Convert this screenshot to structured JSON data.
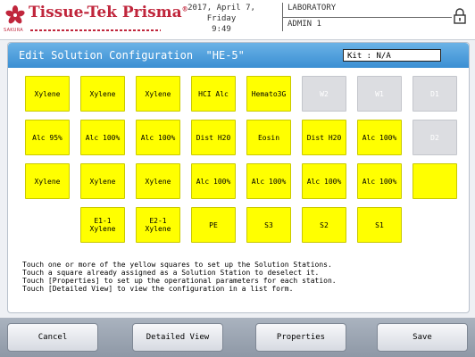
{
  "header": {
    "brand": "Tissue-Tek Prisma",
    "brand_sub": "SAKURA",
    "date_line1": "2017, April 7, Friday",
    "date_line2": "9:49",
    "lab": "LABORATORY",
    "user": "ADMIN 1"
  },
  "panel": {
    "title": "Edit Solution Configuration  \"HE-5\"",
    "kit": "Kit : N/A"
  },
  "grid": {
    "rows": [
      [
        {
          "label": "Xylene",
          "state": "yellow"
        },
        {
          "label": "Xylene",
          "state": "yellow"
        },
        {
          "label": "Xylene",
          "state": "yellow"
        },
        {
          "label": "HCI Alc",
          "state": "yellow"
        },
        {
          "label": "Hemato3G",
          "state": "yellow"
        },
        {
          "label": "W2",
          "state": "gray"
        },
        {
          "label": "W1",
          "state": "gray"
        },
        {
          "label": "D1",
          "state": "gray"
        }
      ],
      [
        {
          "label": "Alc 95%",
          "state": "yellow"
        },
        {
          "label": "Alc 100%",
          "state": "yellow"
        },
        {
          "label": "Alc 100%",
          "state": "yellow"
        },
        {
          "label": "Dist H20",
          "state": "yellow"
        },
        {
          "label": "Eosin",
          "state": "yellow"
        },
        {
          "label": "Dist H20",
          "state": "yellow"
        },
        {
          "label": "Alc 100%",
          "state": "yellow"
        },
        {
          "label": "D2",
          "state": "gray"
        }
      ],
      [
        {
          "label": "Xylene",
          "state": "yellow"
        },
        {
          "label": "Xylene",
          "state": "yellow"
        },
        {
          "label": "Xylene",
          "state": "yellow"
        },
        {
          "label": "Alc 100%",
          "state": "yellow"
        },
        {
          "label": "Alc 100%",
          "state": "yellow"
        },
        {
          "label": "Alc 100%",
          "state": "yellow"
        },
        {
          "label": "Alc 100%",
          "state": "yellow"
        },
        {
          "label": "",
          "state": "yellow"
        }
      ],
      [
        null,
        {
          "label": "E1-1\nXylene",
          "state": "yellow"
        },
        {
          "label": "E2-1\nXylene",
          "state": "yellow"
        },
        {
          "label": "PE",
          "state": "yellow"
        },
        {
          "label": "S3",
          "state": "yellow"
        },
        {
          "label": "S2",
          "state": "yellow"
        },
        {
          "label": "S1",
          "state": "yellow"
        },
        null
      ]
    ]
  },
  "instructions": [
    "Touch one or more of the yellow squares to set up the Solution Stations.",
    "Touch a square already assigned as a Solution Station to deselect it.",
    "Touch [Properties] to set up the operational parameters for each station.",
    "Touch [Detailed View] to view the configuration in a list form."
  ],
  "buttons": {
    "cancel": "Cancel",
    "detailed_view": "Detailed View",
    "properties": "Properties",
    "save": "Save"
  },
  "colors": {
    "brand": "#c0263c",
    "cell_yellow": "#ffff00",
    "cell_gray": "#dcdde1",
    "titlebar": "#4a9edb"
  },
  "icons": {
    "logo": "sakura-flower-icon",
    "lock": "padlock-icon"
  }
}
